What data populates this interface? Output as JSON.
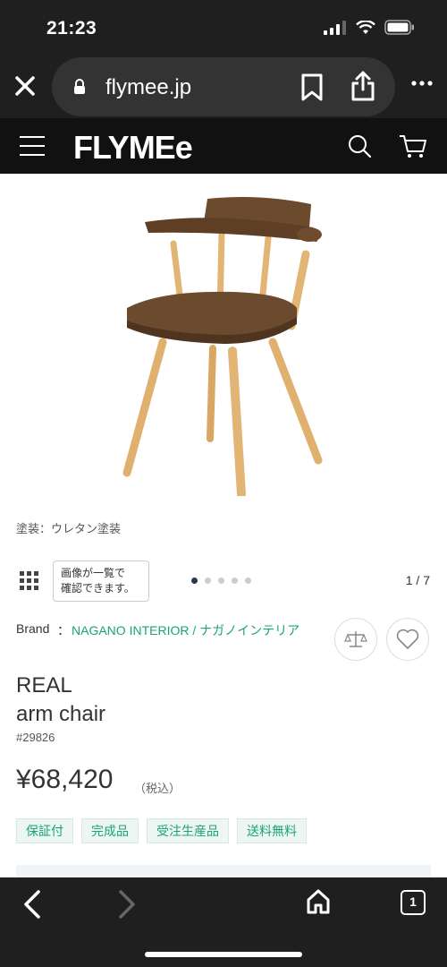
{
  "status": {
    "time": "21:23"
  },
  "browser": {
    "url": "flymee.jp",
    "tab_count": "1"
  },
  "site": {
    "logo": "FLYMEe"
  },
  "product": {
    "caption": "塗装：ウレタン塗装",
    "tooltip_line1": "画像が一覧で",
    "tooltip_line2": "確認できます。",
    "image_counter": "1 / 7",
    "carousel_dots": 5,
    "carousel_active": 0,
    "brand_label": "Brand",
    "brand_separator": "：",
    "brand_name": "NAGANO INTERIOR / ナガノインテリア",
    "name_line1": "REAL",
    "name_line2": "arm chair",
    "id": "#29826",
    "price": "¥68,420",
    "tax_note": "（税込）",
    "tags": [
      "保証付",
      "完成品",
      "受注生産品",
      "送料無料"
    ]
  },
  "colors": {
    "accent": "#1aa37a",
    "header_bg": "#111111",
    "chrome_bg": "#1f1f1f"
  },
  "icons": [
    "close-icon",
    "lock-icon",
    "bookmark-icon",
    "share-icon",
    "more-icon",
    "menu-icon",
    "search-icon",
    "cart-icon",
    "grid-icon",
    "compare-icon",
    "heart-icon",
    "back-icon",
    "forward-icon",
    "home-icon",
    "tabs-icon"
  ]
}
